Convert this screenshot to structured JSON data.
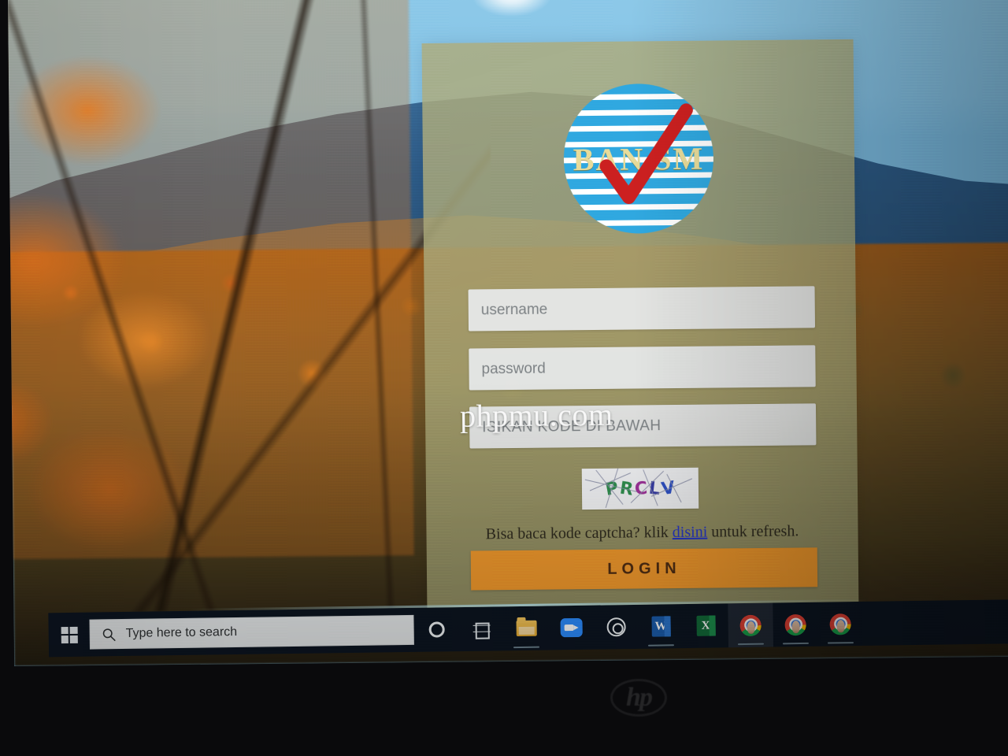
{
  "device": {
    "brand_logo": "hp",
    "bezel_name": "laptop-bezel"
  },
  "desktop": {
    "wallpaper_description": "autumn mountain forest"
  },
  "login": {
    "panel_name": "ban-sm-login-panel",
    "logo": {
      "text": "BAN SM",
      "check_color": "#cc2020",
      "disc_color": "#2fa8e0",
      "text_color": "#e8dc9a"
    },
    "fields": [
      {
        "name": "username",
        "placeholder": "username",
        "value": "",
        "type": "text"
      },
      {
        "name": "password",
        "placeholder": "password",
        "value": "",
        "type": "password"
      },
      {
        "name": "captcha",
        "placeholder": "ISIKAN KODE DI BAWAH",
        "value": "",
        "type": "text"
      }
    ],
    "captcha": {
      "code": "PRCLV",
      "letters": [
        {
          "char": "P",
          "color": "#2f8f4e",
          "rotate": -10
        },
        {
          "char": "R",
          "color": "#2f8f4e",
          "rotate": 9
        },
        {
          "char": "C",
          "color": "#a0329b",
          "rotate": -4
        },
        {
          "char": "L",
          "color": "#3a3fa8",
          "rotate": 7
        },
        {
          "char": "V",
          "color": "#2f52c8",
          "rotate": -8
        }
      ]
    },
    "hint": {
      "before": "Bisa baca kode captcha? klik ",
      "link": "disini",
      "after": " untuk refresh.",
      "link_color": "#2535c8"
    },
    "submit_label": "LOGIN",
    "submit_color": "#f0982b"
  },
  "watermark": {
    "text": "phpmu.com"
  },
  "taskbar": {
    "start_name": "windows-start",
    "search": {
      "placeholder": "Type here to search",
      "value": "Type here to search"
    },
    "items": [
      {
        "name": "cortana-icon",
        "label": "Cortana",
        "active": false,
        "running": false
      },
      {
        "name": "task-view-icon",
        "label": "Task View",
        "active": false,
        "running": false
      },
      {
        "name": "file-explorer-icon",
        "label": "File Explorer",
        "active": false,
        "running": true
      },
      {
        "name": "zoom-icon",
        "label": "Zoom",
        "active": false,
        "running": false
      },
      {
        "name": "obs-studio-icon",
        "label": "OBS Studio",
        "active": false,
        "running": false
      },
      {
        "name": "word-icon",
        "label": "Word",
        "active": false,
        "running": true
      },
      {
        "name": "excel-icon",
        "label": "Excel",
        "active": false,
        "running": false
      },
      {
        "name": "chrome-icon-1",
        "label": "Google Chrome",
        "active": true,
        "running": true
      },
      {
        "name": "chrome-icon-2",
        "label": "Google Chrome",
        "active": false,
        "running": true
      },
      {
        "name": "chrome-icon-3",
        "label": "Google Chrome",
        "active": false,
        "running": true
      }
    ],
    "word_glyph": "W",
    "excel_glyph": "X"
  }
}
